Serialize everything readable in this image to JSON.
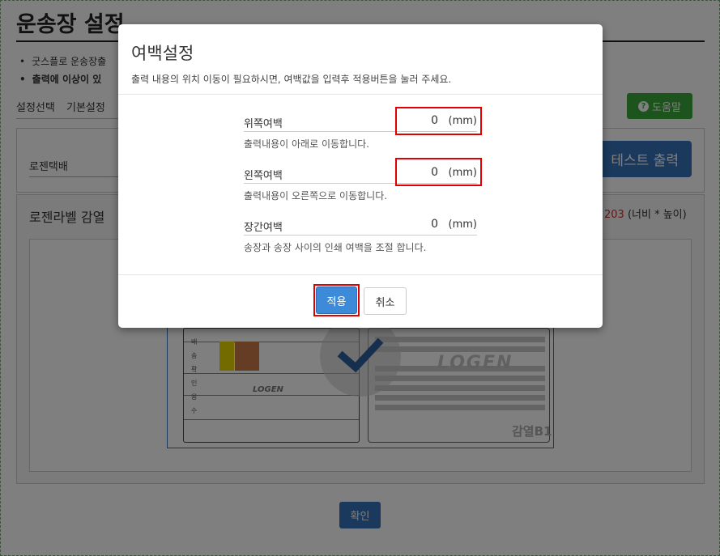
{
  "page": {
    "title": "운송장 설정",
    "notices": [
      "굿스플로 운송장출",
      "출력에 이상이 있"
    ],
    "tabs": [
      "설정선택",
      "기본설정"
    ],
    "help_button": "도움말",
    "carrier": "로젠택배",
    "test_print_button": "테스트 출력",
    "label_title": "로젠라벨 감열",
    "label_size_highlight": "203",
    "label_size_suffix": "(너비 * 높이)",
    "confirm_button": "확인"
  },
  "label_preview": {
    "vertical_text": [
      "배",
      "송",
      "확",
      "인",
      "용",
      "수"
    ],
    "logo_text": "LOGEN",
    "thermal_tag": "감열B1"
  },
  "modal": {
    "title": "여백설정",
    "description": "출력 내용의 위치 이동이 필요하시면, 여백값을 입력후 적용버튼을 눌러 주세요.",
    "fields": [
      {
        "label": "위쪽여백",
        "value": "0",
        "unit": "(mm)",
        "help": "출력내용이 아래로 이동합니다."
      },
      {
        "label": "왼쪽여백",
        "value": "0",
        "unit": "(mm)",
        "help": "출력내용이 오른쪽으로 이동합니다."
      },
      {
        "label": "장간여백",
        "value": "0",
        "unit": "(mm)",
        "help": "송장과 송장 사이의 인쇄 여백을 조절 합니다."
      }
    ],
    "apply_button": "적용",
    "cancel_button": "취소"
  },
  "colors": {
    "primary": "#3472b8",
    "success": "#3aa63a",
    "highlight": "#e00000",
    "accent_red": "#c9302c"
  },
  "icons": [
    "question-circle-icon",
    "checkmark-icon"
  ]
}
